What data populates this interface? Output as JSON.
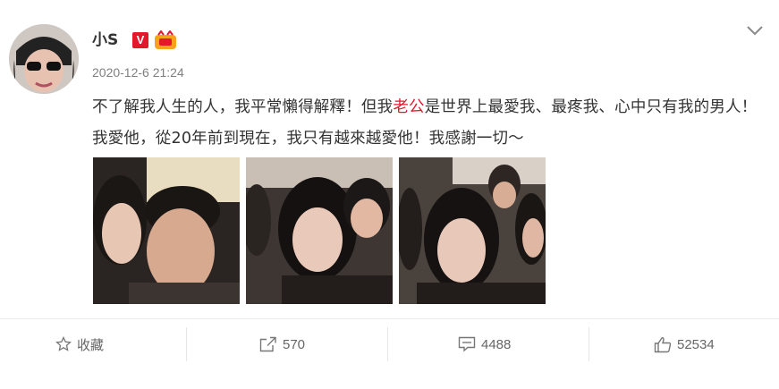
{
  "post": {
    "author": "小S",
    "timestamp": "2020-12-6 21:24",
    "text_before": "不了解我人生的人，我平常懶得解釋！但我",
    "text_highlight": "老公",
    "text_after": "是世界上最愛我、最疼我、心中只有我的男人！我愛他，從20年前到現在，我只有越來越愛他！我感謝一切～",
    "highlight_color": "#e6162d"
  },
  "icons": [
    "verified-v-icon",
    "member-badge-icon",
    "chevron-down-icon",
    "star-icon",
    "share-icon",
    "comment-icon",
    "like-icon"
  ],
  "photos": [
    "photo-1",
    "photo-2",
    "photo-3"
  ],
  "actions": {
    "favorite_label": "收藏",
    "share_count": "570",
    "comment_count": "4488",
    "like_count": "52534"
  }
}
